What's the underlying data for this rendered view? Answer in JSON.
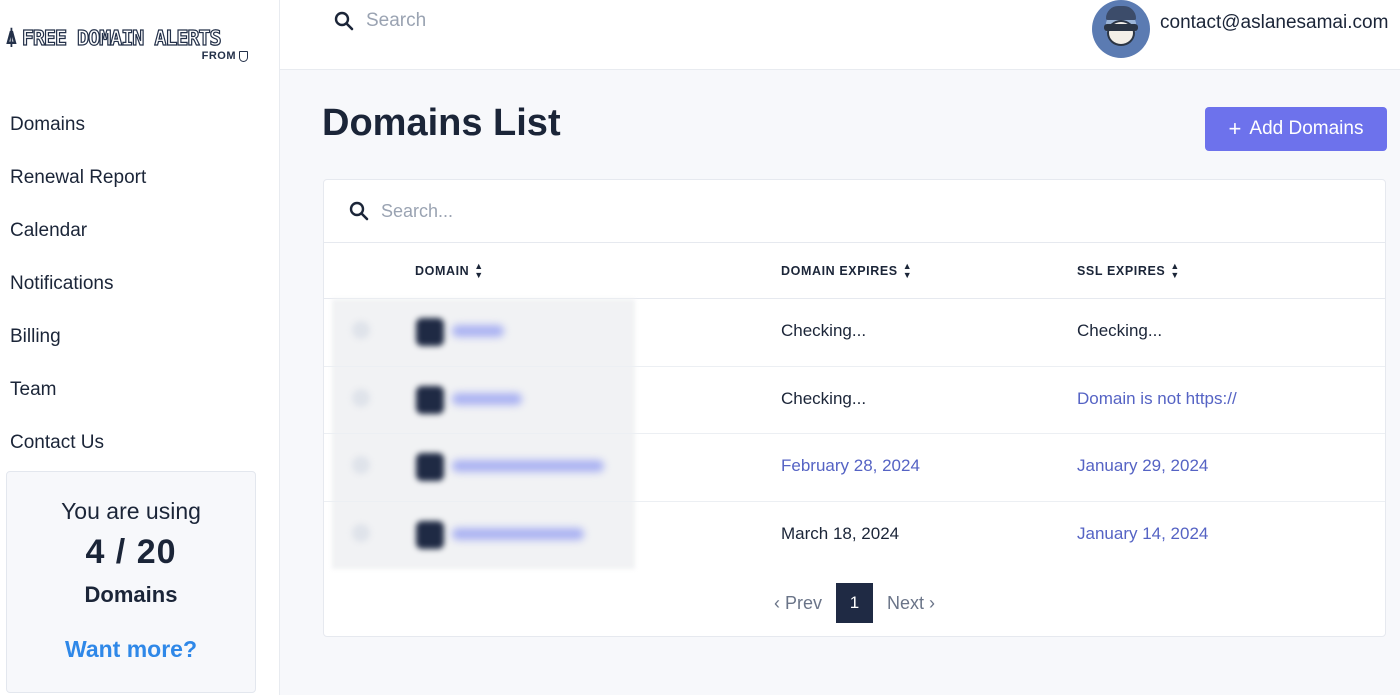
{
  "sidebar": {
    "logo": {
      "main": "FREE DOMAIN ALERTS",
      "sub": "FROM"
    },
    "nav": [
      {
        "label": "Domains"
      },
      {
        "label": "Renewal Report"
      },
      {
        "label": "Calendar"
      },
      {
        "label": "Notifications"
      },
      {
        "label": "Billing"
      },
      {
        "label": "Team"
      },
      {
        "label": "Contact Us"
      }
    ],
    "usage": {
      "line1": "You are using",
      "count": "4 / 20",
      "unit": "Domains",
      "more_link": "Want more?"
    }
  },
  "topbar": {
    "search_placeholder": "Search",
    "user_email": "contact@aslanesamai.com"
  },
  "main": {
    "title": "Domains List",
    "add_button": "Add Domains",
    "table_search_placeholder": "Search...",
    "columns": [
      "DOMAIN",
      "DOMAIN EXPIRES",
      "SSL EXPIRES"
    ],
    "rows": [
      {
        "domain_expires": "Checking...",
        "ssl_expires": "Checking...",
        "domain_link": false,
        "ssl_link": false
      },
      {
        "domain_expires": "Checking...",
        "ssl_expires": "Domain is not https://",
        "domain_link": false,
        "ssl_link": true
      },
      {
        "domain_expires": "February 28, 2024",
        "ssl_expires": "January 29, 2024",
        "domain_link": true,
        "ssl_link": true
      },
      {
        "domain_expires": "March 18, 2024",
        "ssl_expires": "January 14, 2024",
        "domain_link": false,
        "ssl_link": true
      }
    ],
    "pagination": {
      "prev": "‹ Prev",
      "current": "1",
      "next": "Next ›"
    }
  },
  "colors": {
    "accent": "#6d72ec",
    "link": "#5563c4",
    "more_link": "#2f88e8",
    "dark": "#1f2a44"
  }
}
